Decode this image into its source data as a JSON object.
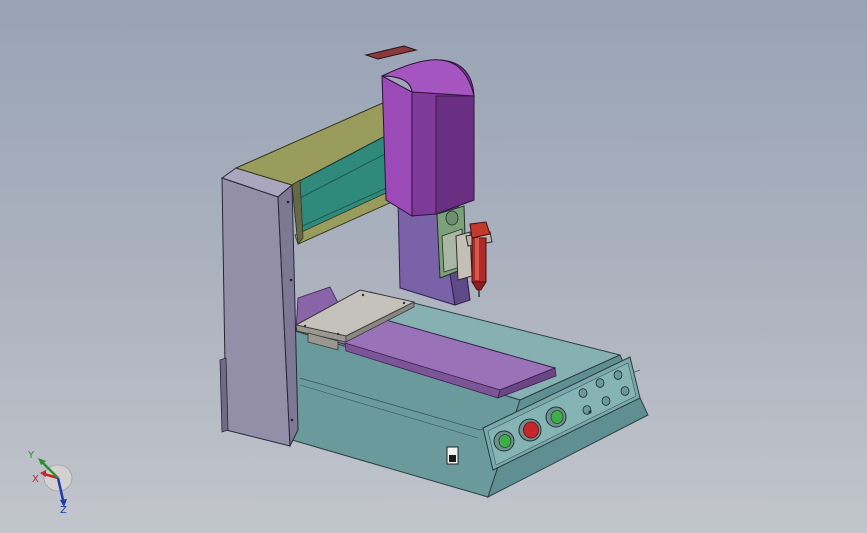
{
  "triad": {
    "y_label": "Y",
    "x_label": "X",
    "z_label": "Z"
  },
  "colors": {
    "background_top": "#98a3b6",
    "background_bottom": "#c2c5cc",
    "base_teal": "#6e9fa0",
    "column_lavender": "#9890aa",
    "gantry_olive": "#9a9c5e",
    "rail_teal": "#2f8a7c",
    "head_purple": "#9c4ab8",
    "table_violet": "#9a72b8",
    "plate_grey": "#aeaba6",
    "syringe_red": "#b02a2a",
    "button_green": "#3fae4a",
    "button_red": "#c8262a"
  }
}
